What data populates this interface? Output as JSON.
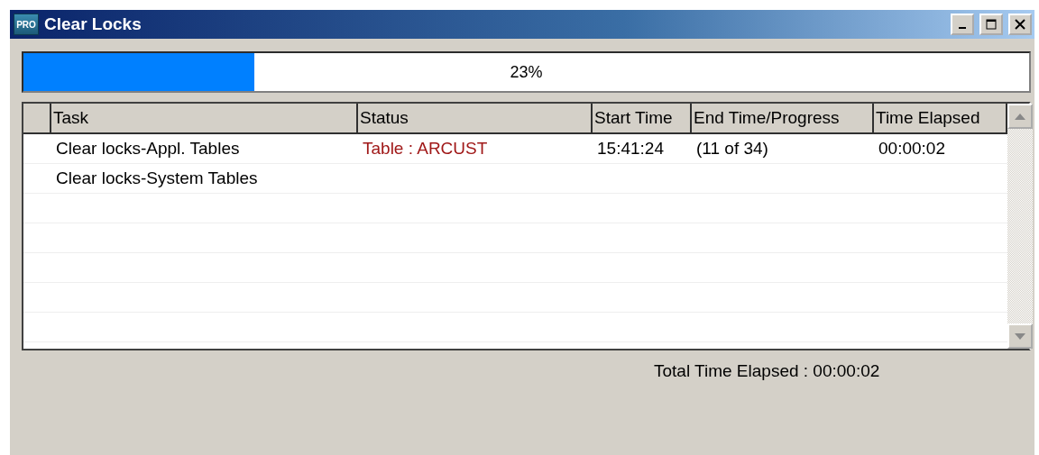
{
  "window": {
    "icon_text": "PRO",
    "title": "Clear Locks"
  },
  "progress": {
    "level": 0.23,
    "reading": "23%"
  },
  "table": {
    "columns": [
      "Task",
      "Status",
      "Start Time",
      "End Time/Progress",
      "Time Elapsed"
    ],
    "rows": [
      [
        "Clear locks-Appl. Tables",
        "Table : ARCUST",
        "15:41:24",
        "(11 of 34)",
        "00:00:02"
      ],
      [
        "Clear locks-System Tables",
        "",
        "",
        "",
        ""
      ]
    ]
  },
  "total": "Total Time Elapsed : 00:00:02"
}
